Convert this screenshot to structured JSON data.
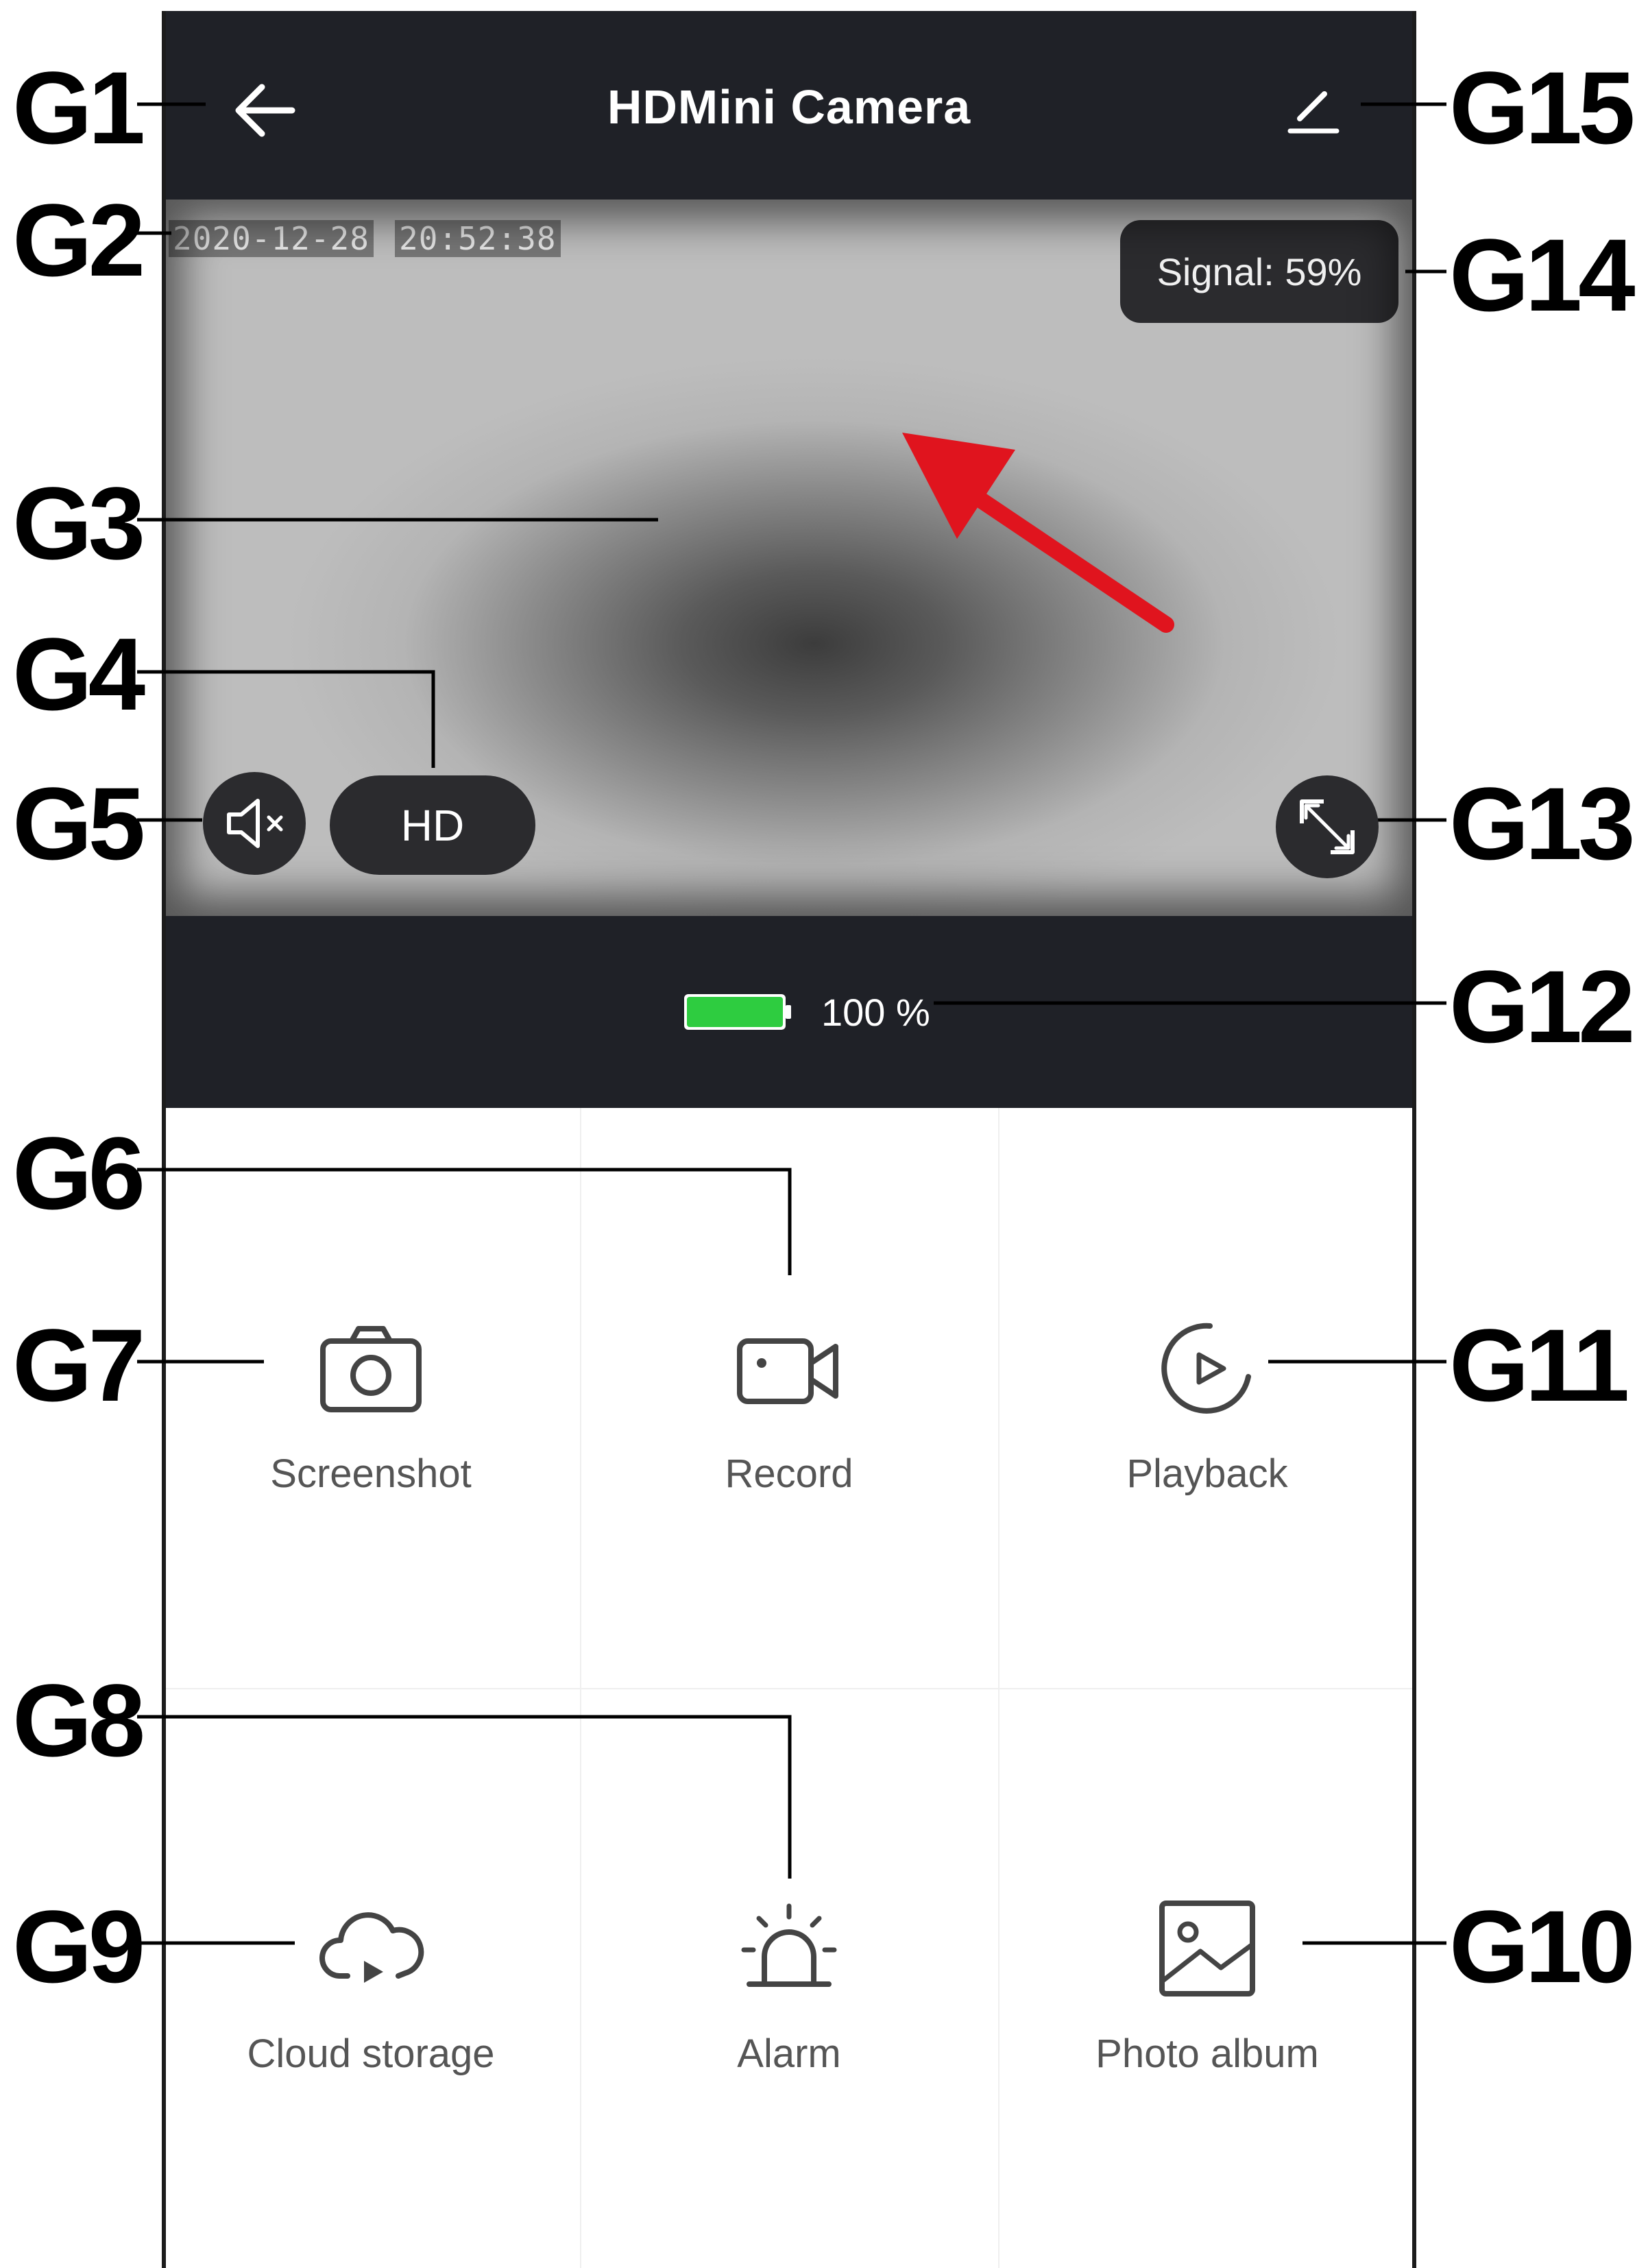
{
  "header": {
    "title": "HDMini Camera",
    "back_icon": "arrow-left-icon",
    "edit_icon": "pencil-icon"
  },
  "video": {
    "date": "2020-12-28",
    "time": "20:52:38",
    "signal": "Signal: 59%",
    "quality_label": "HD",
    "mute_icon": "speaker-muted-icon",
    "fullscreen_icon": "fullscreen-icon"
  },
  "battery": {
    "percent_text": "100 %",
    "level": 1.0,
    "color": "#2ecc40"
  },
  "actions": [
    {
      "label": "Screenshot",
      "icon": "camera-icon"
    },
    {
      "label": "Record",
      "icon": "video-camera-icon"
    },
    {
      "label": "Playback",
      "icon": "playback-icon"
    },
    {
      "label": "Cloud storage",
      "icon": "cloud-icon"
    },
    {
      "label": "Alarm",
      "icon": "alarm-siren-icon"
    },
    {
      "label": "Photo album",
      "icon": "image-icon"
    }
  ],
  "callouts": {
    "g1": "G1",
    "g2": "G2",
    "g3": "G3",
    "g4": "G4",
    "g5": "G5",
    "g6": "G6",
    "g7": "G7",
    "g8": "G8",
    "g9": "G9",
    "g10": "G10",
    "g11": "G11",
    "g12": "G12",
    "g13": "G13",
    "g14": "G14",
    "g15": "G15"
  },
  "colors": {
    "bar_background": "#1f2127",
    "pill_background": "#2b2b2e",
    "annotation_arrow": "#e0141e"
  }
}
